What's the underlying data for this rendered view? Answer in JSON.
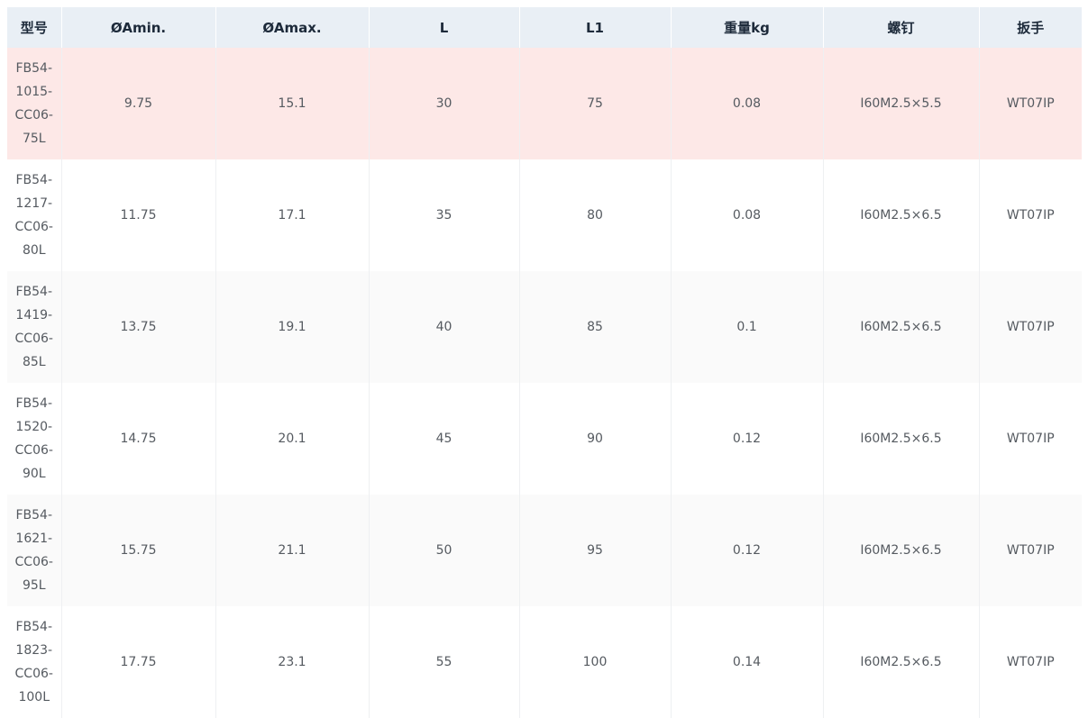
{
  "table": {
    "headers": [
      "型号",
      "ØAmin.",
      "ØAmax.",
      "L",
      "L1",
      "重量kg",
      "螺钉",
      "扳手"
    ],
    "rows": [
      {
        "model": [
          "FB54-",
          "1015-",
          "CC06-",
          "75L"
        ],
        "amin": "9.75",
        "amax": "15.1",
        "l": "30",
        "l1": "75",
        "weight": "0.08",
        "screw": "I60M2.5×5.5",
        "wrench": "WT07IP",
        "highlighted": true
      },
      {
        "model": [
          "FB54-",
          "1217-",
          "CC06-",
          "80L"
        ],
        "amin": "11.75",
        "amax": "17.1",
        "l": "35",
        "l1": "80",
        "weight": "0.08",
        "screw": "I60M2.5×6.5",
        "wrench": "WT07IP",
        "highlighted": false
      },
      {
        "model": [
          "FB54-",
          "1419-",
          "CC06-",
          "85L"
        ],
        "amin": "13.75",
        "amax": "19.1",
        "l": "40",
        "l1": "85",
        "weight": "0.1",
        "screw": "I60M2.5×6.5",
        "wrench": "WT07IP",
        "highlighted": false
      },
      {
        "model": [
          "FB54-",
          "1520-",
          "CC06-",
          "90L"
        ],
        "amin": "14.75",
        "amax": "20.1",
        "l": "45",
        "l1": "90",
        "weight": "0.12",
        "screw": "I60M2.5×6.5",
        "wrench": "WT07IP",
        "highlighted": false
      },
      {
        "model": [
          "FB54-",
          "1621-",
          "CC06-",
          "95L"
        ],
        "amin": "15.75",
        "amax": "21.1",
        "l": "50",
        "l1": "95",
        "weight": "0.12",
        "screw": "I60M2.5×6.5",
        "wrench": "WT07IP",
        "highlighted": false
      },
      {
        "model": [
          "FB54-",
          "1823-",
          "CC06-",
          "100L"
        ],
        "amin": "17.75",
        "amax": "23.1",
        "l": "55",
        "l1": "100",
        "weight": "0.14",
        "screw": "I60M2.5×6.5",
        "wrench": "WT07IP",
        "highlighted": false
      }
    ]
  },
  "colors": {
    "header_bg": "#e9eff5",
    "highlight_row": "#fde8e7",
    "stripe_row": "#fafafa",
    "text": "#555a60"
  }
}
